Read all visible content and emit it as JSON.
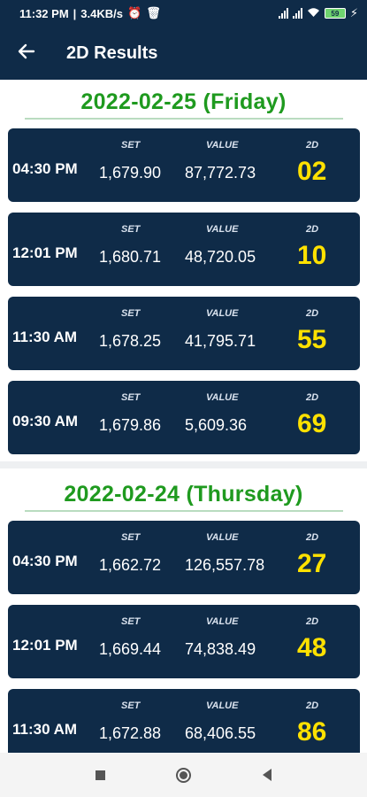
{
  "status_bar": {
    "time": "11:32 PM",
    "speed": "3.4KB/s",
    "battery": "59"
  },
  "app_bar": {
    "title": "2D Results"
  },
  "labels": {
    "set": "SET",
    "value": "VALUE",
    "d2": "2D"
  },
  "groups": [
    {
      "date": "2022-02-25 (Friday)",
      "results": [
        {
          "time": "04:30 PM",
          "set": "1,679.90",
          "value": "87,772.73",
          "d2": "02"
        },
        {
          "time": "12:01 PM",
          "set": "1,680.71",
          "value": "48,720.05",
          "d2": "10"
        },
        {
          "time": "11:30 AM",
          "set": "1,678.25",
          "value": "41,795.71",
          "d2": "55"
        },
        {
          "time": "09:30 AM",
          "set": "1,679.86",
          "value": "5,609.36",
          "d2": "69"
        }
      ]
    },
    {
      "date": "2022-02-24 (Thursday)",
      "results": [
        {
          "time": "04:30 PM",
          "set": "1,662.72",
          "value": "126,557.78",
          "d2": "27"
        },
        {
          "time": "12:01 PM",
          "set": "1,669.44",
          "value": "74,838.49",
          "d2": "48"
        },
        {
          "time": "11:30 AM",
          "set": "1,672.88",
          "value": "68,406.55",
          "d2": "86"
        }
      ]
    }
  ],
  "icons": {
    "back": "arrow-left-icon",
    "recents": "square-icon",
    "home": "circle-icon",
    "nav_back": "triangle-left-icon"
  },
  "colors": {
    "primary": "#0f2b48",
    "date_green": "#1f9a1f",
    "twod_yellow": "#ffe100"
  }
}
